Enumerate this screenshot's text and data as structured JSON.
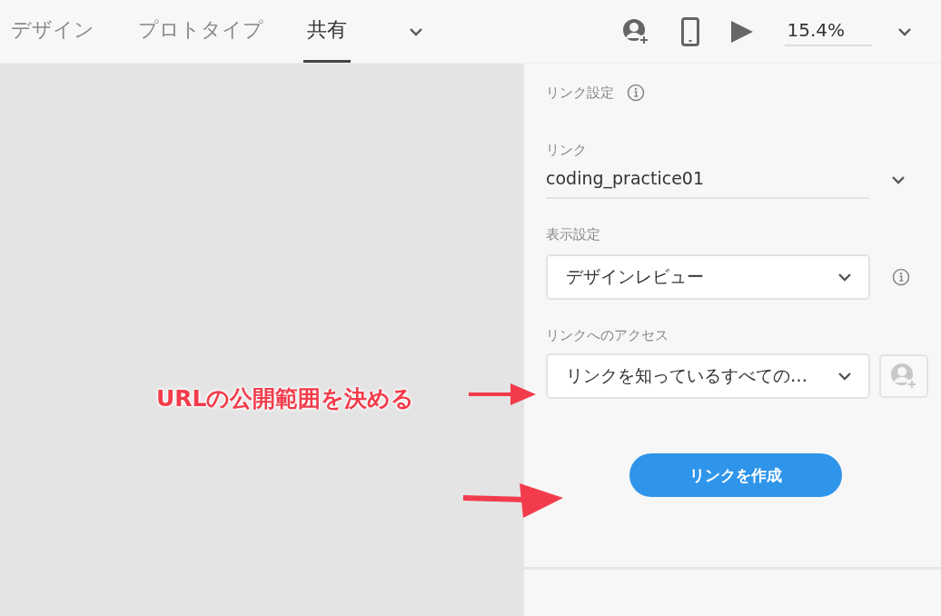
{
  "tabs": [
    {
      "label": "デザイン",
      "selected": false
    },
    {
      "label": "プロトタイプ",
      "selected": false
    },
    {
      "label": "共有",
      "selected": true
    }
  ],
  "toolbar": {
    "zoom": "15.4%"
  },
  "panel": {
    "title": "リンク設定",
    "link": {
      "label": "リンク",
      "value": "coding_practice01"
    },
    "view_setting": {
      "label": "表示設定",
      "value": "デザインレビュー"
    },
    "access": {
      "label": "リンクへのアクセス",
      "value": "リンクを知っているすべての…"
    },
    "create_button": "リンクを作成"
  },
  "annotations": [
    {
      "text": "URLの公開範囲を決める"
    }
  ]
}
